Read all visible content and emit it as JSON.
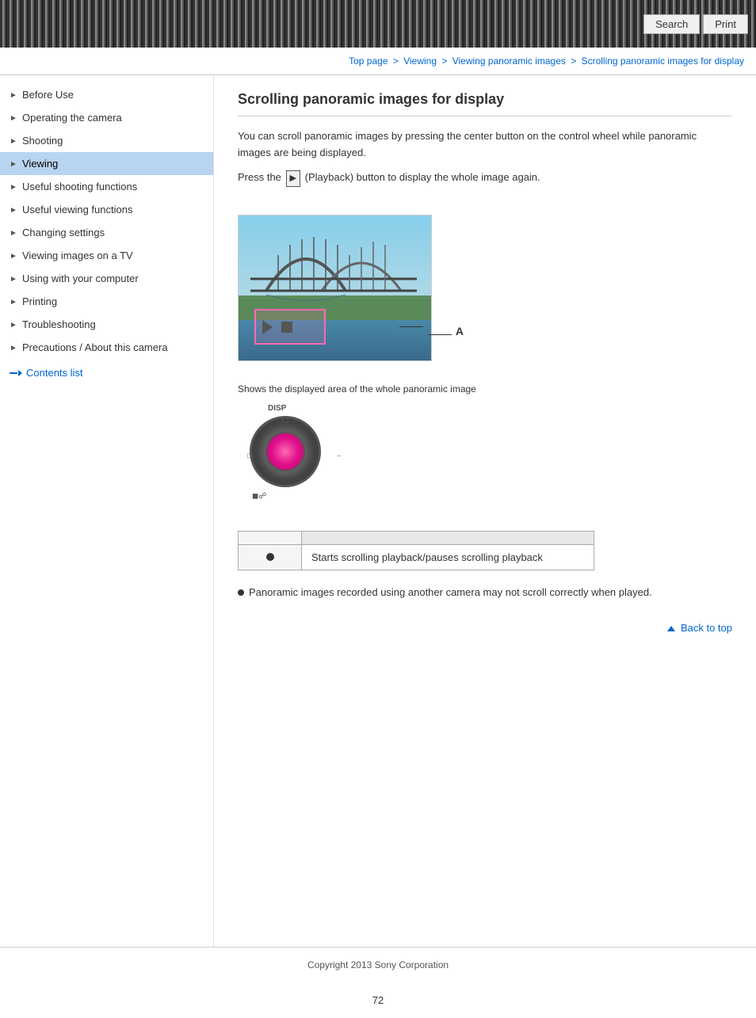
{
  "header": {
    "search_label": "Search",
    "print_label": "Print"
  },
  "breadcrumb": {
    "top_page": "Top page",
    "viewing": "Viewing",
    "viewing_panoramic": "Viewing panoramic images",
    "scrolling": "Scrolling panoramic images for display"
  },
  "sidebar": {
    "items": [
      {
        "id": "before-use",
        "label": "Before Use",
        "active": false
      },
      {
        "id": "operating-camera",
        "label": "Operating the camera",
        "active": false
      },
      {
        "id": "shooting",
        "label": "Shooting",
        "active": false
      },
      {
        "id": "viewing",
        "label": "Viewing",
        "active": true
      },
      {
        "id": "useful-shooting",
        "label": "Useful shooting functions",
        "active": false
      },
      {
        "id": "useful-viewing",
        "label": "Useful viewing functions",
        "active": false
      },
      {
        "id": "changing-settings",
        "label": "Changing settings",
        "active": false
      },
      {
        "id": "viewing-tv",
        "label": "Viewing images on a TV",
        "active": false
      },
      {
        "id": "using-computer",
        "label": "Using with your computer",
        "active": false
      },
      {
        "id": "printing",
        "label": "Printing",
        "active": false
      },
      {
        "id": "troubleshooting",
        "label": "Troubleshooting",
        "active": false
      },
      {
        "id": "precautions",
        "label": "Precautions / About this camera",
        "active": false
      }
    ],
    "contents_list": "Contents list"
  },
  "page": {
    "title": "Scrolling panoramic images for display",
    "description1": "You can scroll panoramic images by pressing the center button on the control wheel while panoramic images are being displayed.",
    "description2_prefix": "Press the",
    "description2_icon": "▶",
    "description2_suffix": "(Playback) button to display the whole image again.",
    "area_label": "Shows the displayed area of the whole panoramic image",
    "label_a": "A",
    "table": {
      "header_symbol": "",
      "header_description": "",
      "rows": [
        {
          "symbol": "●",
          "description": "Starts scrolling playback/pauses scrolling playback"
        }
      ]
    },
    "note": "Panoramic images recorded using another camera may not scroll correctly when played.",
    "back_to_top": "Back to top"
  },
  "footer": {
    "copyright": "Copyright 2013 Sony Corporation",
    "page_number": "72"
  }
}
